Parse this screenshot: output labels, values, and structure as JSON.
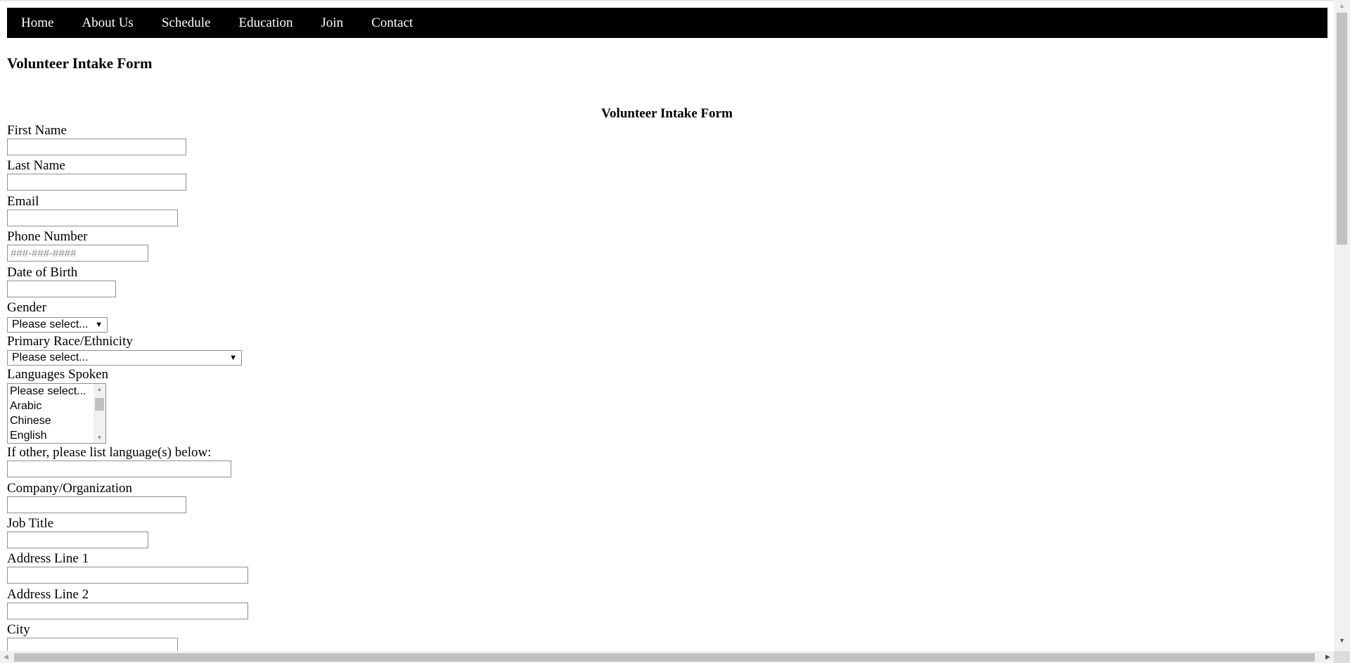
{
  "nav": {
    "items": [
      "Home",
      "About Us",
      "Schedule",
      "Education",
      "Join",
      "Contact"
    ]
  },
  "page": {
    "title": "Volunteer Intake Form"
  },
  "form": {
    "title": "Volunteer Intake Form",
    "first_name": {
      "label": "First Name",
      "value": "",
      "placeholder": ""
    },
    "last_name": {
      "label": "Last Name",
      "value": "",
      "placeholder": ""
    },
    "email": {
      "label": "Email",
      "value": "",
      "placeholder": ""
    },
    "phone": {
      "label": "Phone Number",
      "value": "",
      "placeholder": "###-###-####"
    },
    "dob": {
      "label": "Date of Birth",
      "value": "",
      "placeholder": ""
    },
    "gender": {
      "label": "Gender",
      "selected": "Please select..."
    },
    "race": {
      "label": "Primary Race/Ethnicity",
      "selected": "Please select..."
    },
    "languages": {
      "label": "Languages Spoken",
      "options": [
        "Please select...",
        "Arabic",
        "Chinese",
        "English"
      ]
    },
    "other_languages": {
      "label": "If other, please list language(s) below:",
      "value": ""
    },
    "company": {
      "label": "Company/Organization",
      "value": ""
    },
    "job_title": {
      "label": "Job Title",
      "value": ""
    },
    "address1": {
      "label": "Address Line 1",
      "value": ""
    },
    "address2": {
      "label": "Address Line 2",
      "value": ""
    },
    "city": {
      "label": "City",
      "value": ""
    }
  },
  "icons": {
    "dropdown_arrow": "▼",
    "scroll_up": "▲",
    "scroll_down": "▼",
    "scroll_left": "◀",
    "scroll_right": "▶"
  }
}
